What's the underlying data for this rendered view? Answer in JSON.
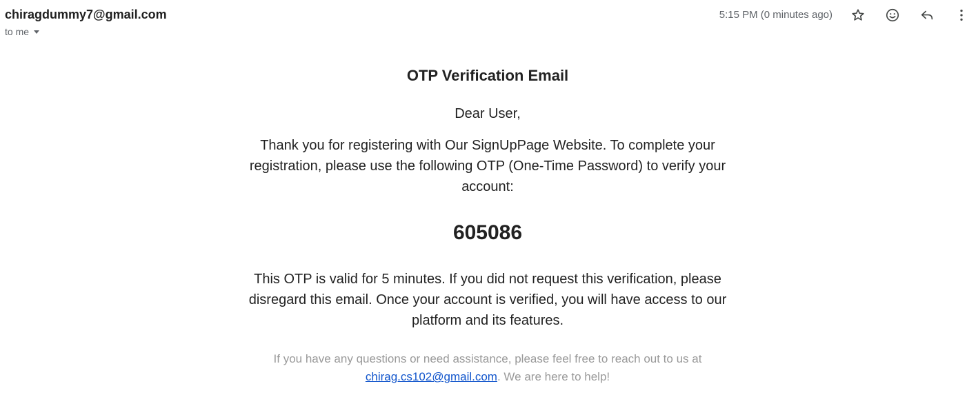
{
  "header": {
    "sender_email": "chiragdummy7@gmail.com",
    "recipient_label": "to me",
    "timestamp": "5:15 PM (0 minutes ago)",
    "icons": [
      "star-icon",
      "emoji-icon",
      "reply-icon",
      "more-vert-icon"
    ]
  },
  "body": {
    "title": "OTP Verification Email",
    "greeting": "Dear User,",
    "intro": "Thank you for registering with Our SignUpPage Website. To complete your registration, please use the following OTP (One-Time Password) to verify your account:",
    "otp": "605086",
    "validity": "This OTP is valid for 5 minutes. If you did not request this verification, please disregard this email. Once your account is verified, you will have access to our platform and its features.",
    "footer_before": "If you have any questions or need assistance, please feel free to reach out to us at",
    "footer_link": "chirag.cs102@gmail.com",
    "footer_after": ". We are here to help!"
  },
  "colors": {
    "link": "#1155cc",
    "muted": "#999999",
    "icon": "#444746"
  }
}
